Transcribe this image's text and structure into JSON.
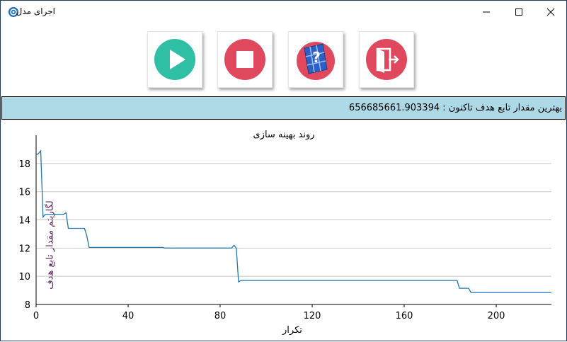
{
  "window": {
    "title": "اجرای مدل"
  },
  "toolbar": [
    {
      "name": "run-button",
      "icon": "play-icon",
      "color": "#2ebfa5"
    },
    {
      "name": "stop-button",
      "icon": "stop-icon",
      "color": "#e0485e"
    },
    {
      "name": "help-button",
      "icon": "help-cube-icon",
      "color": "#e0485e"
    },
    {
      "name": "exit-button",
      "icon": "exit-door-icon",
      "color": "#e0485e"
    }
  ],
  "status": {
    "text": "بهترین مقدار تابع هدف تاکنون : 656685661.903394"
  },
  "chart_data": {
    "type": "line",
    "title": "روند بهینه سازی",
    "xlabel": "تکرار",
    "ylabel": "لگاریتم مقدار تابع هدف",
    "xlim": [
      0,
      224
    ],
    "ylim": [
      8,
      19.5
    ],
    "xticks": [
      0,
      40,
      80,
      120,
      160,
      200
    ],
    "yticks": [
      8,
      10,
      12,
      14,
      16,
      18
    ],
    "grid": "horizontal",
    "line_color": "#1f77b4",
    "series": [
      {
        "x": [
          0,
          1,
          2,
          3,
          4,
          12,
          13,
          14,
          21,
          22,
          23,
          55,
          56,
          85,
          86,
          87,
          88,
          89,
          183,
          184,
          188,
          189,
          224
        ],
        "y": [
          18.6,
          18.7,
          18.9,
          14.2,
          14.4,
          14.4,
          14.5,
          13.4,
          13.4,
          12.9,
          12.05,
          12.05,
          12.0,
          12.0,
          12.2,
          12.0,
          9.6,
          9.7,
          9.7,
          9.15,
          9.15,
          8.85,
          8.85
        ]
      }
    ]
  }
}
